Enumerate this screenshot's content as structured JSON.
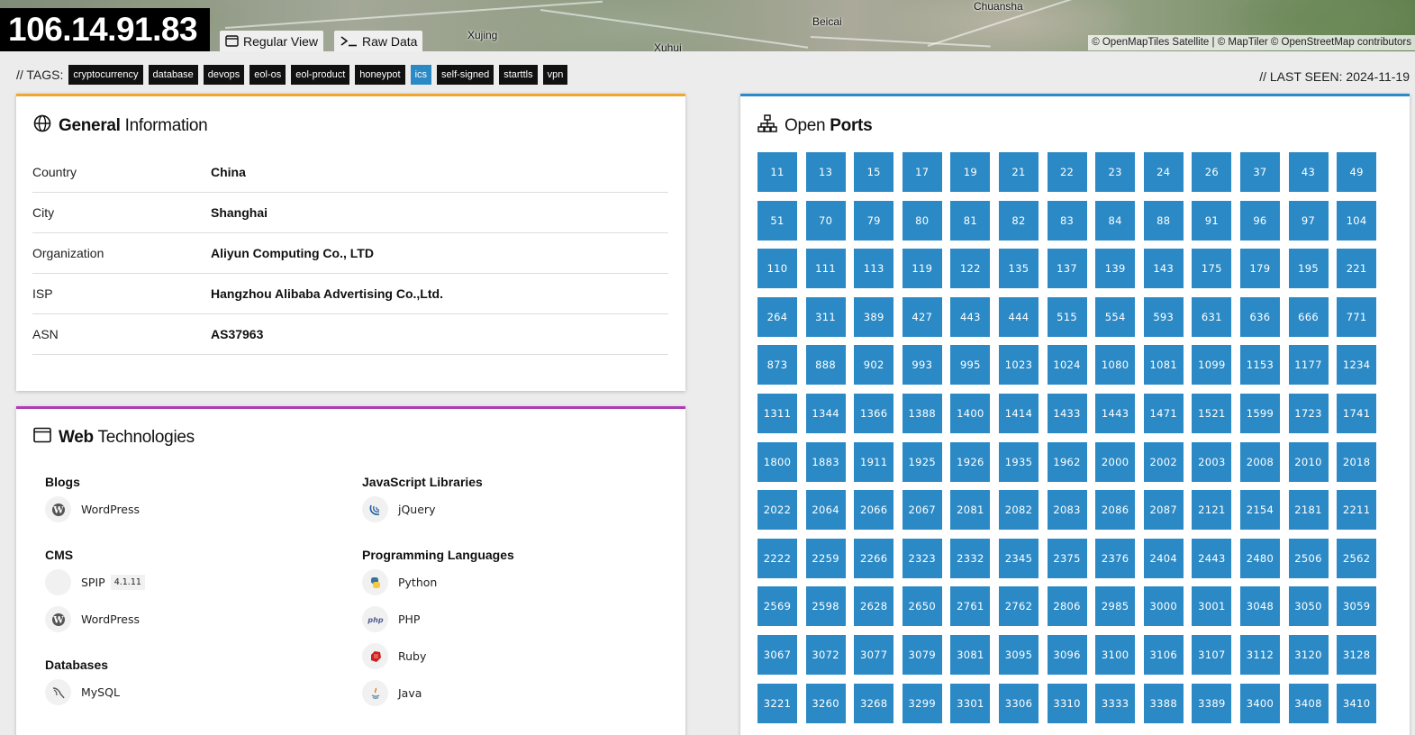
{
  "header": {
    "ip": "106.14.91.83",
    "buttons": {
      "regular_view": "Regular View",
      "raw_data": "Raw Data"
    },
    "map": {
      "places": [
        "Xujing",
        "Beicai",
        "Chuansha",
        "Xuhui"
      ],
      "attribution": "© OpenMapTiles Satellite | © MapTiler © OpenStreetMap contributors"
    }
  },
  "tags": {
    "label": "// TAGS:",
    "items": [
      {
        "label": "cryptocurrency",
        "highlight": false
      },
      {
        "label": "database",
        "highlight": false
      },
      {
        "label": "devops",
        "highlight": false
      },
      {
        "label": "eol-os",
        "highlight": false
      },
      {
        "label": "eol-product",
        "highlight": false
      },
      {
        "label": "honeypot",
        "highlight": false
      },
      {
        "label": "ics",
        "highlight": true
      },
      {
        "label": "self-signed",
        "highlight": false
      },
      {
        "label": "starttls",
        "highlight": false
      },
      {
        "label": "vpn",
        "highlight": false
      }
    ]
  },
  "last_seen": "// LAST SEEN: 2024-11-19",
  "general": {
    "title_bold": "General",
    "title_light": "Information",
    "rows": [
      {
        "key": "Country",
        "value": "China"
      },
      {
        "key": "City",
        "value": "Shanghai"
      },
      {
        "key": "Organization",
        "value": "Aliyun Computing Co., LTD"
      },
      {
        "key": "ISP",
        "value": "Hangzhou Alibaba Advertising Co.,Ltd."
      },
      {
        "key": "ASN",
        "value": "AS37963"
      }
    ]
  },
  "web": {
    "title_bold": "Web",
    "title_light": "Technologies",
    "left": {
      "blogs": {
        "title": "Blogs",
        "items": [
          {
            "name": "WordPress",
            "icon": "wordpress-icon"
          }
        ]
      },
      "cms": {
        "title": "CMS",
        "items": [
          {
            "name": "SPIP",
            "icon": "spip-icon",
            "version": "4.1.11"
          },
          {
            "name": "WordPress",
            "icon": "wordpress-icon"
          }
        ]
      },
      "databases": {
        "title": "Databases",
        "items": [
          {
            "name": "MySQL",
            "icon": "mysql-icon"
          }
        ]
      }
    },
    "right": {
      "js": {
        "title": "JavaScript Libraries",
        "items": [
          {
            "name": "jQuery",
            "icon": "jquery-icon"
          }
        ]
      },
      "langs": {
        "title": "Programming Languages",
        "items": [
          {
            "name": "Python",
            "icon": "python-icon"
          },
          {
            "name": "PHP",
            "icon": "php-icon"
          },
          {
            "name": "Ruby",
            "icon": "ruby-icon"
          },
          {
            "name": "Java",
            "icon": "java-icon"
          }
        ]
      }
    }
  },
  "ports": {
    "title_light": "Open",
    "title_bold": "Ports",
    "color": "#2b8ac6",
    "list": [
      "11",
      "13",
      "15",
      "17",
      "19",
      "21",
      "22",
      "23",
      "24",
      "26",
      "37",
      "43",
      "49",
      "51",
      "70",
      "79",
      "80",
      "81",
      "82",
      "83",
      "84",
      "88",
      "91",
      "96",
      "97",
      "104",
      "110",
      "111",
      "113",
      "119",
      "122",
      "135",
      "137",
      "139",
      "143",
      "175",
      "179",
      "195",
      "221",
      "264",
      "311",
      "389",
      "427",
      "443",
      "444",
      "515",
      "554",
      "593",
      "631",
      "636",
      "666",
      "771",
      "873",
      "888",
      "902",
      "993",
      "995",
      "1023",
      "1024",
      "1080",
      "1081",
      "1099",
      "1153",
      "1177",
      "1234",
      "1311",
      "1344",
      "1366",
      "1388",
      "1400",
      "1414",
      "1433",
      "1443",
      "1471",
      "1521",
      "1599",
      "1723",
      "1741",
      "1800",
      "1883",
      "1911",
      "1925",
      "1926",
      "1935",
      "1962",
      "2000",
      "2002",
      "2003",
      "2008",
      "2010",
      "2018",
      "2022",
      "2064",
      "2066",
      "2067",
      "2081",
      "2082",
      "2083",
      "2086",
      "2087",
      "2121",
      "2154",
      "2181",
      "2211",
      "2222",
      "2259",
      "2266",
      "2323",
      "2332",
      "2345",
      "2375",
      "2376",
      "2404",
      "2443",
      "2480",
      "2506",
      "2562",
      "2569",
      "2598",
      "2628",
      "2650",
      "2761",
      "2762",
      "2806",
      "2985",
      "3000",
      "3001",
      "3048",
      "3050",
      "3059",
      "3067",
      "3072",
      "3077",
      "3079",
      "3081",
      "3095",
      "3096",
      "3100",
      "3106",
      "3107",
      "3112",
      "3120",
      "3128",
      "3221",
      "3260",
      "3268",
      "3299",
      "3301",
      "3306",
      "3310",
      "3333",
      "3388",
      "3389",
      "3400",
      "3408",
      "3410"
    ]
  }
}
